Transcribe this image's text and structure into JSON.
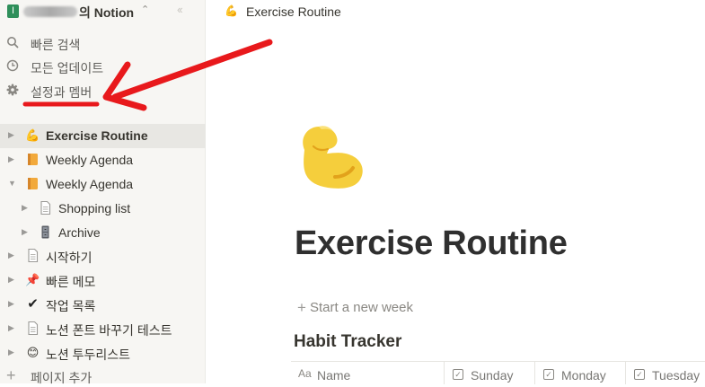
{
  "workspace": {
    "avatar_letter": "I",
    "name_suffix": "의 Notion",
    "switch_icon": "chevron-updown-icon",
    "collapse_icon": "double-chevron-left-icon"
  },
  "menu": [
    {
      "label": "빠른 검색",
      "icon": "search-icon"
    },
    {
      "label": "모든 업데이트",
      "icon": "clock-icon"
    },
    {
      "label": "설정과 멤버",
      "icon": "gear-icon"
    }
  ],
  "pages": [
    {
      "label": "Exercise Routine",
      "icon": "💪",
      "active": true
    },
    {
      "label": "Weekly Agenda",
      "icon": "notebook-icon"
    },
    {
      "label": "Weekly Agenda",
      "icon": "notebook-icon",
      "expanded": true
    },
    {
      "label": "Shopping list",
      "icon": "page-icon"
    },
    {
      "label": "Archive",
      "icon": "cabinet-icon"
    },
    {
      "label": "시작하기",
      "icon": "page-icon"
    },
    {
      "label": "빠른 메모",
      "icon": "📌"
    },
    {
      "label": "작업 목록",
      "icon": "✔"
    },
    {
      "label": "노션 폰트 바꾸기 테스트",
      "icon": "page-icon"
    },
    {
      "label": "노션 투두리스트",
      "icon": "😊"
    }
  ],
  "add_page_label": "페이지 추가",
  "breadcrumb": {
    "icon": "💪",
    "label": "Exercise Routine"
  },
  "page": {
    "icon": "flexed-biceps-icon",
    "title": "Exercise Routine",
    "new_week_label": "Start a new week",
    "db_title": "Habit Tracker",
    "columns": [
      {
        "label": "Name",
        "icon": "Aa"
      },
      {
        "label": "Sunday",
        "icon": "checkbox-icon"
      },
      {
        "label": "Monday",
        "icon": "checkbox-icon"
      },
      {
        "label": "Tuesday",
        "icon": "checkbox-icon"
      }
    ]
  },
  "colors": {
    "sidebar_bg": "#f7f6f3",
    "annotation_red": "#e8191c",
    "avatar_green": "#2f8f5a"
  }
}
